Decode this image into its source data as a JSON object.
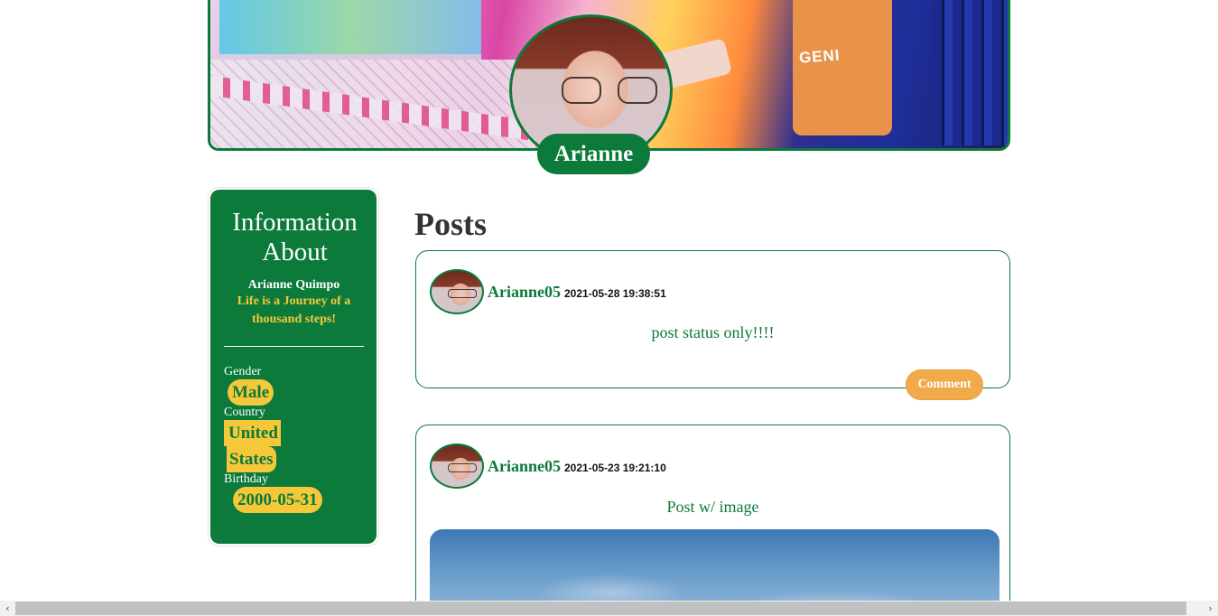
{
  "profile": {
    "display_name": "Arianne",
    "cover_print": "I WAS BORN\nGENIUS\nEdu"
  },
  "info": {
    "heading": "Information About",
    "full_name": "Arianne Quimpo",
    "motto": "Life is a Journey of a thousand steps!",
    "gender_label": "Gender",
    "gender_value": "Male",
    "country_label": "Country",
    "country_value_line1": "United",
    "country_value_line2": "States",
    "birthday_label": "Birthday",
    "birthday_value": "2000-05-31"
  },
  "posts": {
    "title": "Posts",
    "items": [
      {
        "username": "Arianne05",
        "timestamp": "2021-05-28 19:38:51",
        "text": "post status only!!!!",
        "comment_label": "Comment"
      },
      {
        "username": "Arianne05",
        "timestamp": "2021-05-23 19:21:10",
        "text": "Post w/ image"
      }
    ]
  },
  "scrollbar": {
    "left_arrow": "‹",
    "right_arrow": "›"
  },
  "colors": {
    "brand_green": "#0b7a3a",
    "accent_yellow": "#f5c83a",
    "button_orange": "#f0aa4a"
  }
}
